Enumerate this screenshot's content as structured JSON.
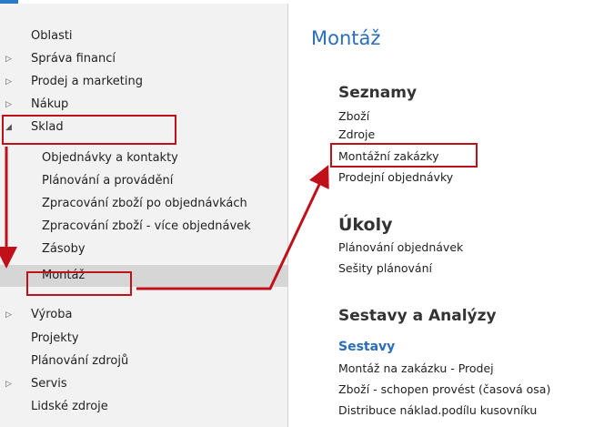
{
  "sidebar": {
    "items": [
      {
        "label": "Oblasti",
        "arrow": ""
      },
      {
        "label": "Správa financí",
        "arrow": "▷"
      },
      {
        "label": "Prodej a marketing",
        "arrow": "▷"
      },
      {
        "label": "Nákup",
        "arrow": "▷"
      },
      {
        "label": "Sklad",
        "arrow": "◢"
      },
      {
        "label": "Objednávky a kontakty",
        "arrow": ""
      },
      {
        "label": "Plánování a provádění",
        "arrow": ""
      },
      {
        "label": "Zpracování zboží po objednávkách",
        "arrow": ""
      },
      {
        "label": "Zpracování zboží - více objednávek",
        "arrow": ""
      },
      {
        "label": "Zásoby",
        "arrow": ""
      },
      {
        "label": "Montáž",
        "arrow": ""
      },
      {
        "label": "Výroba",
        "arrow": "▷"
      },
      {
        "label": "Projekty",
        "arrow": ""
      },
      {
        "label": "Plánování zdrojů",
        "arrow": ""
      },
      {
        "label": "Servis",
        "arrow": "▷"
      },
      {
        "label": "Lidské zdroje",
        "arrow": ""
      }
    ]
  },
  "main": {
    "title": "Montáž",
    "lists": {
      "heading": "Seznamy",
      "items": [
        "Zboží",
        "Zdroje",
        "Montážní zakázky",
        "Prodejní objednávky"
      ]
    },
    "tasks": {
      "heading": "Úkoly",
      "items": [
        "Plánování objednávek",
        "Sešity plánování"
      ]
    },
    "reports": {
      "heading": "Sestavy a Analýzy",
      "subheading": "Sestavy",
      "items": [
        "Montáž na zakázku - Prodej",
        "Zboží - schopen provést (časová osa)",
        "Distribuce náklad.podílu kusovníku"
      ]
    }
  },
  "colors": {
    "accent_blue": "#2a6ebb",
    "annotation_red": "#c0101a"
  }
}
